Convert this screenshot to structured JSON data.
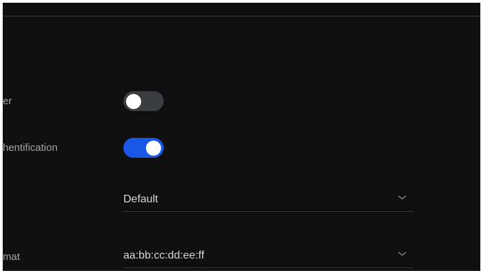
{
  "settings": {
    "rows": [
      {
        "label": "er",
        "control": "toggle",
        "on": false
      },
      {
        "label": "hentification",
        "control": "toggle",
        "on": true
      },
      {
        "label": "",
        "control": "select",
        "value": "Default"
      },
      {
        "label": "mat",
        "control": "select",
        "value": "aa:bb:cc:dd:ee:ff"
      }
    ]
  },
  "icons": {
    "dropdown": "chevron-down-icon"
  },
  "colors": {
    "background": "#0f0f10",
    "toggle_on": "#1a57e6",
    "toggle_off": "#3c3d41",
    "label_text": "#a3a5a8",
    "value_text": "#d7d8da",
    "divider": "#3a3b3e"
  }
}
